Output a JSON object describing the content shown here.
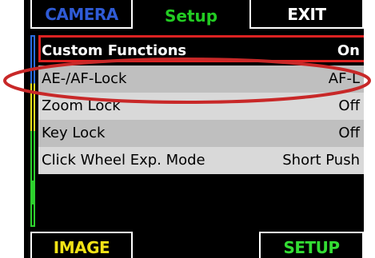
{
  "top_tabs": {
    "camera": "CAMERA",
    "setup": "Setup",
    "exit": "EXIT"
  },
  "menu": {
    "items": [
      {
        "label": "Custom Functions",
        "value": "On"
      },
      {
        "label": "AE-/AF-Lock",
        "value": "AF-L"
      },
      {
        "label": "Zoom Lock",
        "value": "Off"
      },
      {
        "label": "Key Lock",
        "value": "Off"
      },
      {
        "label": "Click Wheel Exp. Mode",
        "value": "Short Push"
      }
    ]
  },
  "bottom_tabs": {
    "image": "IMAGE",
    "setup": "SETUP"
  },
  "colors": {
    "camera_tab": "#2f5bd6",
    "setup_title": "#22cc22",
    "image_tab": "#f2e316",
    "setup_tab": "#33dd33",
    "selection_border": "#dd2222",
    "annotation": "#c82828"
  }
}
